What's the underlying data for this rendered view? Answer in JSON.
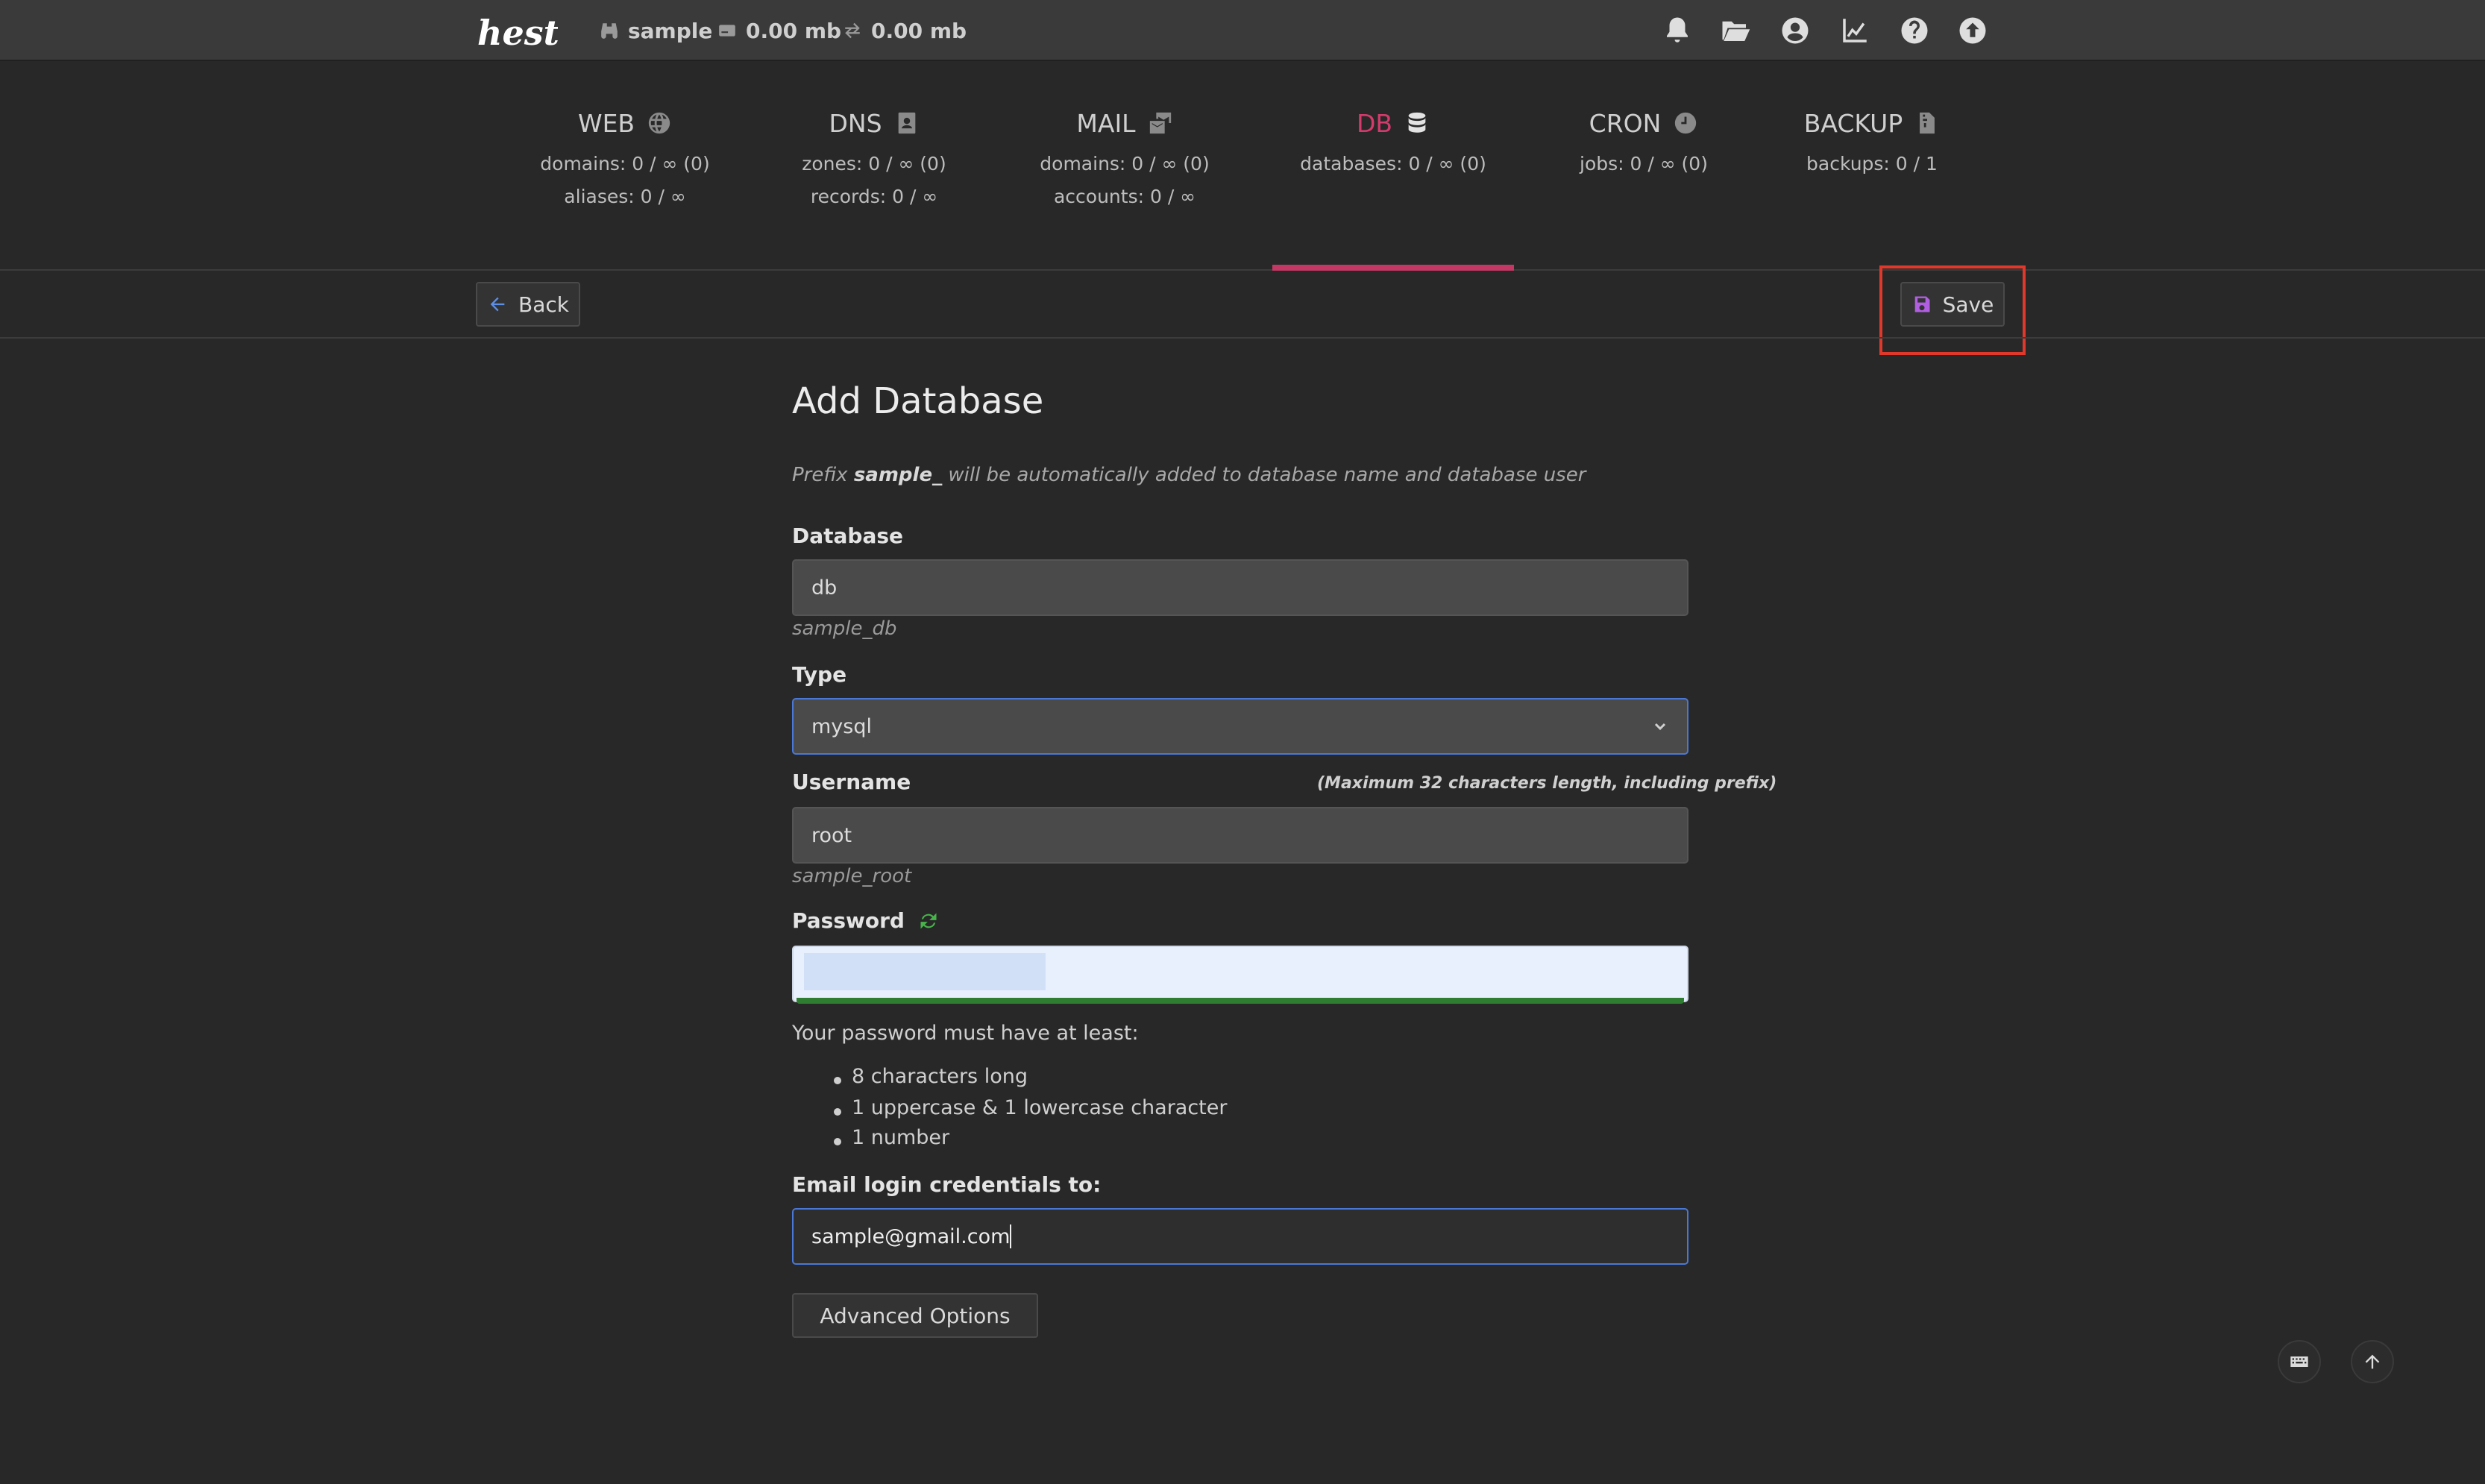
{
  "topbar": {
    "logo_text": "hestia",
    "user": "sample",
    "disk": "0.00 mb",
    "bandwidth": "0.00 mb",
    "icons": [
      "bell-icon",
      "folder-icon",
      "user-circle-icon",
      "chart-line-icon",
      "help-icon",
      "upload-icon"
    ]
  },
  "tabs": [
    {
      "label": "WEB",
      "icon": "globe-icon",
      "line1": "domains: 0 / ∞ (0)",
      "line2": "aliases: 0 / ∞"
    },
    {
      "label": "DNS",
      "icon": "address-book-icon",
      "line1": "zones: 0 / ∞ (0)",
      "line2": "records: 0 / ∞"
    },
    {
      "label": "MAIL",
      "icon": "mail-bulk-icon",
      "line1": "domains: 0 / ∞ (0)",
      "line2": "accounts: 0 / ∞"
    },
    {
      "label": "DB",
      "icon": "database-icon",
      "line1": "databases: 0 / ∞ (0)",
      "line2": ""
    },
    {
      "label": "CRON",
      "icon": "clock-icon",
      "line1": "jobs: 0 / ∞ (0)",
      "line2": ""
    },
    {
      "label": "BACKUP",
      "icon": "file-archive-icon",
      "line1": "backups: 0 / 1",
      "line2": ""
    }
  ],
  "active_tab": "DB",
  "toolbar": {
    "back_label": "Back",
    "save_label": "Save"
  },
  "form": {
    "title": "Add Database",
    "hint_pre": "Prefix ",
    "hint_prefix": "sample_",
    "hint_post": " will be automatically added to database name and database user",
    "database_label": "Database",
    "database_value": "db",
    "database_full": "sample_db",
    "type_label": "Type",
    "type_value": "mysql",
    "username_label": "Username",
    "username_note": "(Maximum 32 characters length, including prefix)",
    "username_value": "root",
    "username_full": "sample_root",
    "password_label": "Password",
    "password_requirements_title": "Your password must have at least:",
    "password_requirements": [
      "8 characters long",
      "1 uppercase & 1 lowercase character",
      "1 number"
    ],
    "email_label": "Email login credentials to:",
    "email_value": "sample@gmail.com",
    "advanced_label": "Advanced Options"
  },
  "colors": {
    "accent": "#c43865",
    "focus": "#4a78d8",
    "save_highlight": "#e0392b",
    "strength_bar": "#2f7d30"
  }
}
